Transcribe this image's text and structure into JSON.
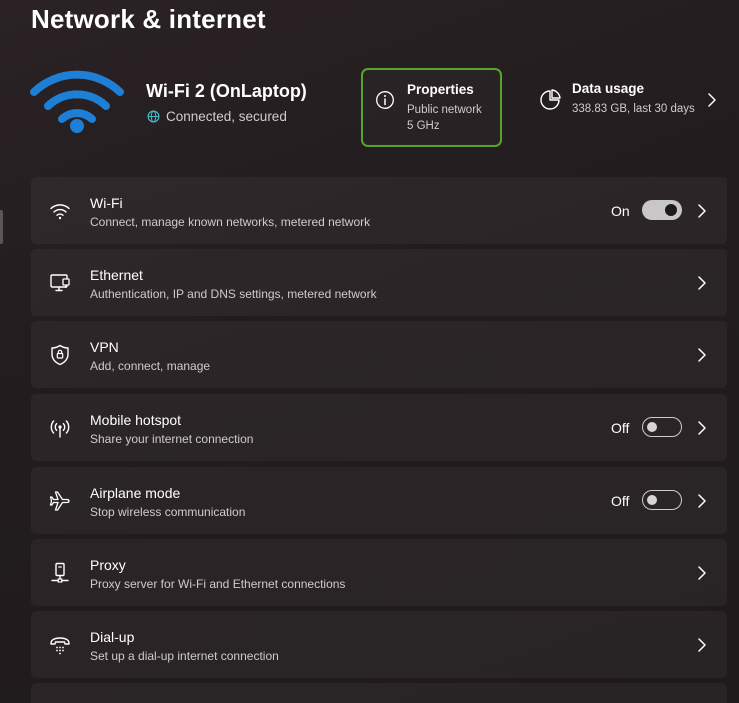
{
  "page": {
    "title": "Network & internet"
  },
  "connection": {
    "name": "Wi-Fi 2 (OnLaptop)",
    "status": "Connected, secured"
  },
  "properties_card": {
    "title": "Properties",
    "line1": "Public network",
    "line2": "5 GHz"
  },
  "data_usage_card": {
    "title": "Data usage",
    "detail": "338.83 GB, last 30 days"
  },
  "settings": [
    {
      "title": "Wi-Fi",
      "subtitle": "Connect, manage known networks, metered network",
      "icon": "wifi-icon",
      "toggle_state": "On",
      "toggle_on": true
    },
    {
      "title": "Ethernet",
      "subtitle": "Authentication, IP and DNS settings, metered network",
      "icon": "ethernet-icon"
    },
    {
      "title": "VPN",
      "subtitle": "Add, connect, manage",
      "icon": "shield-icon"
    },
    {
      "title": "Mobile hotspot",
      "subtitle": "Share your internet connection",
      "icon": "hotspot-icon",
      "toggle_state": "Off",
      "toggle_on": false
    },
    {
      "title": "Airplane mode",
      "subtitle": "Stop wireless communication",
      "icon": "airplane-icon",
      "toggle_state": "Off",
      "toggle_on": false
    },
    {
      "title": "Proxy",
      "subtitle": "Proxy server for Wi-Fi and Ethernet connections",
      "icon": "proxy-icon"
    },
    {
      "title": "Dial-up",
      "subtitle": "Set up a dial-up internet connection",
      "icon": "dialup-icon"
    }
  ],
  "colors": {
    "accent_wifi": "#1e7fd6",
    "focus_outline": "#54a624",
    "status_globe": "#49b6c9"
  }
}
